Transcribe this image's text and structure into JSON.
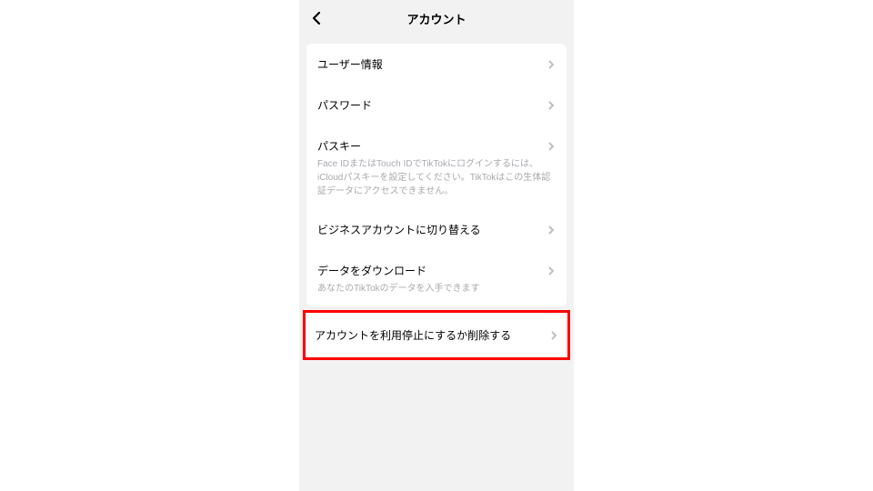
{
  "header": {
    "title": "アカウント"
  },
  "items": [
    {
      "label": "ユーザー情報",
      "sub": null
    },
    {
      "label": "パスワード",
      "sub": null
    },
    {
      "label": "パスキー",
      "sub": "Face IDまたはTouch IDでTikTokにログインするには、iCloudパスキーを設定してください。TikTokはこの生体認証データにアクセスできません。"
    },
    {
      "label": "ビジネスアカウントに切り替える",
      "sub": null
    },
    {
      "label": "データをダウンロード",
      "sub": "あなたのTikTokのデータを入手できます"
    },
    {
      "label": "アカウントを利用停止にするか削除する",
      "sub": null
    }
  ]
}
